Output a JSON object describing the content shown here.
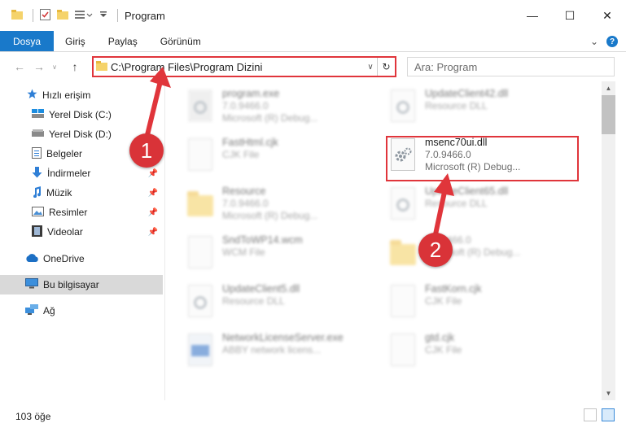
{
  "window": {
    "title": "Program",
    "controls": [
      "minimize-icon",
      "maximize-icon",
      "close-icon"
    ]
  },
  "ribbon": {
    "tabs": [
      {
        "label": "Dosya",
        "active": true
      },
      {
        "label": "Giriş",
        "active": false
      },
      {
        "label": "Paylaş",
        "active": false
      },
      {
        "label": "Görünüm",
        "active": false
      }
    ],
    "help_label": "?"
  },
  "address": {
    "path": "C:\\Program Files\\Program Dizini",
    "search_placeholder": "Ara: Program"
  },
  "sidebar": {
    "items": [
      {
        "label": "Hızlı erişim",
        "icon": "star-icon"
      },
      {
        "label": "Yerel Disk (C:)",
        "icon": "drive-icon"
      },
      {
        "label": "Yerel Disk (D:)",
        "icon": "drive-icon"
      },
      {
        "label": "Belgeler",
        "icon": "documents-icon"
      },
      {
        "label": "İndirmeler",
        "icon": "download-icon"
      },
      {
        "label": "Müzik",
        "icon": "music-icon"
      },
      {
        "label": "Resimler",
        "icon": "pictures-icon"
      },
      {
        "label": "Videolar",
        "icon": "video-icon"
      },
      {
        "label": "OneDrive",
        "icon": "cloud-icon"
      },
      {
        "label": "Bu bilgisayar",
        "icon": "computer-icon"
      },
      {
        "label": "Ağ",
        "icon": "network-icon"
      }
    ]
  },
  "files": [
    {
      "name": "program.exe",
      "line2": "7.0.9466.0",
      "line3": "Microsoft (R) Debug...",
      "kind": "exe"
    },
    {
      "name": "UpdateClient42.dll",
      "line2": "Resource DLL",
      "line3": "",
      "kind": "dll"
    },
    {
      "name": "FastHtml.cjk",
      "line2": "CJK File",
      "line3": "",
      "kind": "file"
    },
    {
      "name": "msenc70ui.dll",
      "line2": "7.0.9466.0",
      "line3": "Microsoft (R) Debug...",
      "kind": "dll"
    },
    {
      "name": "Resource",
      "line2": "7.0.9466.0",
      "line3": "Microsoft (R) Debug...",
      "kind": "folder"
    },
    {
      "name": "UpdateClient65.dll",
      "line2": "Resource DLL",
      "line3": "",
      "kind": "dll"
    },
    {
      "name": "SndToWP14.wcm",
      "line2": "WCM File",
      "line3": "",
      "kind": "file"
    },
    {
      "name": "",
      "line2": "7.0.9466.0",
      "line3": "Microsoft (R) Debug...",
      "kind": "folder"
    },
    {
      "name": "UpdateClient5.dll",
      "line2": "Resource DLL",
      "line3": "",
      "kind": "dll"
    },
    {
      "name": "FastKorn.cjk",
      "line2": "CJK File",
      "line3": "",
      "kind": "file"
    },
    {
      "name": "NetworkLicenseServer.exe",
      "line2": "ABBY network licens...",
      "line3": "",
      "kind": "exe"
    },
    {
      "name": "gtd.cjk",
      "line2": "CJK File",
      "line3": "",
      "kind": "file"
    }
  ],
  "status": {
    "item_count": "103 öğe"
  },
  "annotations": {
    "badge1": "1",
    "badge2": "2",
    "color": "#e0353b"
  }
}
